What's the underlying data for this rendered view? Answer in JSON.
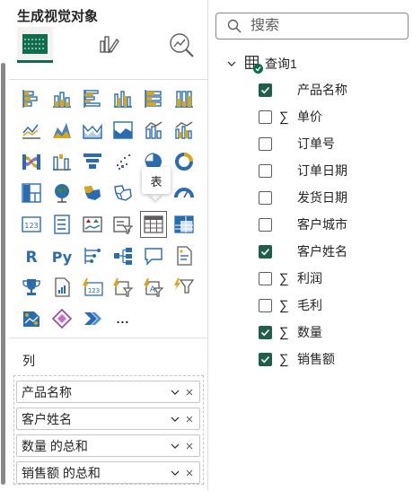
{
  "viz_pane": {
    "title": "生成视觉对象",
    "mode_tabs": [
      {
        "name": "build-visual",
        "selected": true
      },
      {
        "name": "format-visual",
        "selected": false
      },
      {
        "name": "analytics",
        "selected": false
      }
    ],
    "tooltip": "表",
    "more_label": "...",
    "section_label": "列",
    "well_chips": [
      {
        "label": "产品名称"
      },
      {
        "label": "客户姓名"
      },
      {
        "label": "数量 的总和"
      },
      {
        "label": "销售额 的总和"
      }
    ]
  },
  "data_pane": {
    "search_placeholder": "搜索",
    "table_name": "查询1",
    "fields": [
      {
        "label": "产品名称",
        "checked": true,
        "sigma": false
      },
      {
        "label": "单价",
        "checked": false,
        "sigma": true
      },
      {
        "label": "订单号",
        "checked": false,
        "sigma": false
      },
      {
        "label": "订单日期",
        "checked": false,
        "sigma": false
      },
      {
        "label": "发货日期",
        "checked": false,
        "sigma": false
      },
      {
        "label": "客户城市",
        "checked": false,
        "sigma": false
      },
      {
        "label": "客户姓名",
        "checked": true,
        "sigma": false
      },
      {
        "label": "利润",
        "checked": false,
        "sigma": true
      },
      {
        "label": "毛利",
        "checked": false,
        "sigma": true
      },
      {
        "label": "数量",
        "checked": true,
        "sigma": true
      },
      {
        "label": "销售额",
        "checked": true,
        "sigma": true
      }
    ],
    "sigma_symbol": "∑"
  },
  "colors": {
    "accent": "#0f6c4d",
    "checkbox_checked": "#1f5f4a",
    "viz_blue": "#2b6cb0",
    "viz_gold": "#d8a617"
  }
}
